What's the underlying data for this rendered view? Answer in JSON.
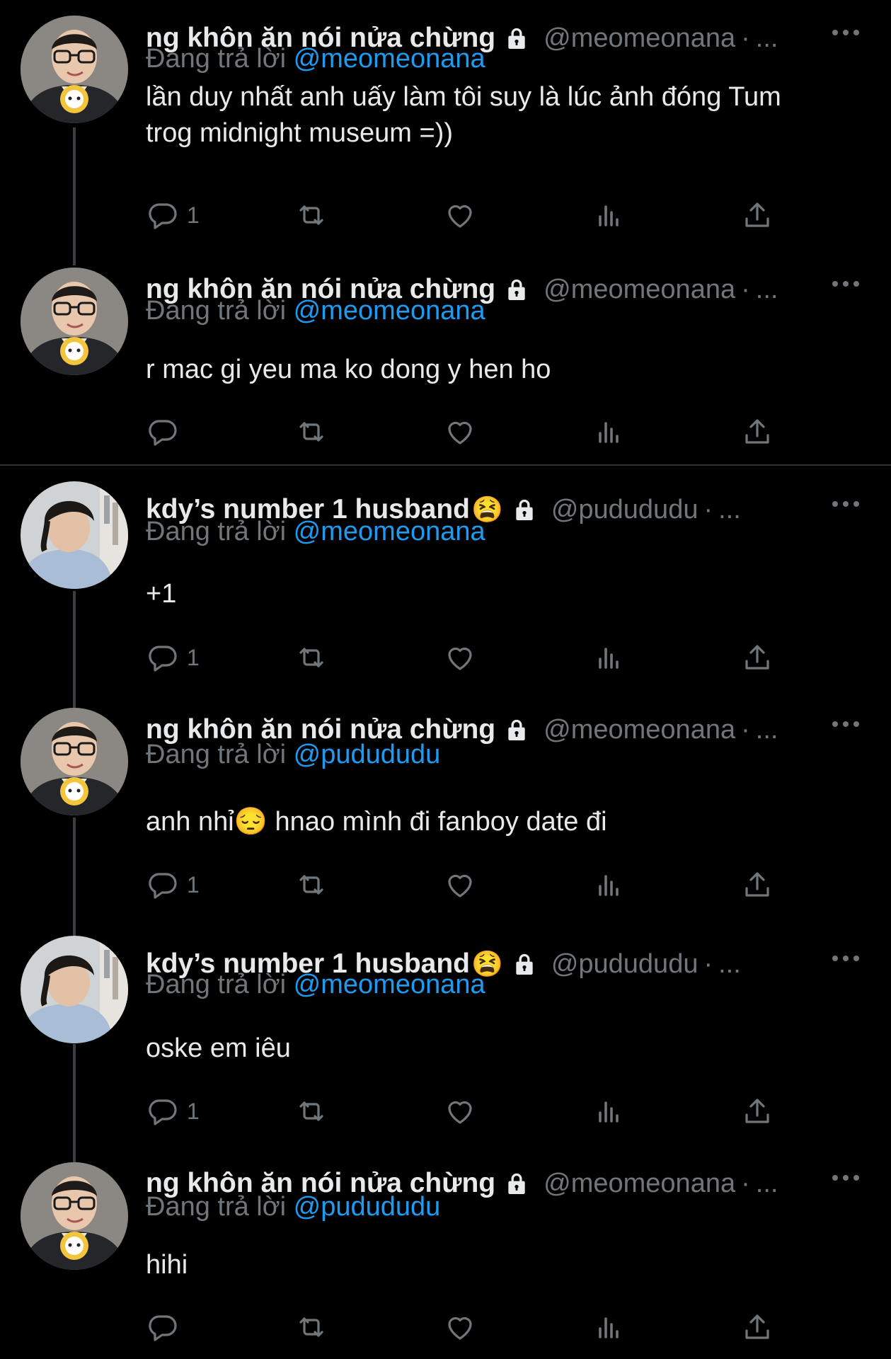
{
  "reply_prefix": "Đang trả lời",
  "tweets": [
    {
      "name": "ng khôn ăn nói nửa chừng",
      "emoji": "",
      "handle": "@meomeonana",
      "dot": "·",
      "ellipsis": "...",
      "reply_to": "@meomeonana",
      "text": "lần duy nhất anh uấy làm tôi suy là lúc ảnh đóng Tum trog midnight museum =))",
      "reply_count": "1",
      "avatar": "avatar-meomeonana"
    },
    {
      "name": "ng khôn ăn nói nửa chừng",
      "emoji": "",
      "handle": "@meomeonana",
      "dot": "·",
      "ellipsis": "...",
      "reply_to": "@meomeonana",
      "text": "r mac gi yeu ma ko dong y hen ho",
      "reply_count": "",
      "avatar": "avatar-meomeonana"
    },
    {
      "name": "kdy’s number 1 husband",
      "emoji": "😫",
      "handle": "@pudududu",
      "dot": "·",
      "ellipsis": "...",
      "reply_to": "@meomeonana",
      "text": "+1",
      "reply_count": "1",
      "avatar": "avatar-pudududu"
    },
    {
      "name": "ng khôn ăn nói nửa chừng",
      "emoji": "",
      "handle": "@meomeonana",
      "dot": "·",
      "ellipsis": "...",
      "reply_to": "@pudududu",
      "text": "anh nhỉ😔 hnao mình đi fanboy date đi",
      "reply_count": "1",
      "avatar": "avatar-meomeonana"
    },
    {
      "name": "kdy’s number 1 husband",
      "emoji": "😫",
      "handle": "@pudududu",
      "dot": "·",
      "ellipsis": "...",
      "reply_to": "@meomeonana",
      "text": "oske em iêu",
      "reply_count": "1",
      "avatar": "avatar-pudududu"
    },
    {
      "name": "ng khôn ăn nói nửa chừng",
      "emoji": "",
      "handle": "@meomeonana",
      "dot": "·",
      "ellipsis": "...",
      "reply_to": "@pudududu",
      "text": "hihi",
      "reply_count": "",
      "avatar": "avatar-meomeonana"
    }
  ],
  "colors": {
    "background": "#000000",
    "text": "#e7e9ea",
    "muted": "#71767b",
    "mention": "#1d9bf0",
    "thread_line": "#3a3d41"
  }
}
